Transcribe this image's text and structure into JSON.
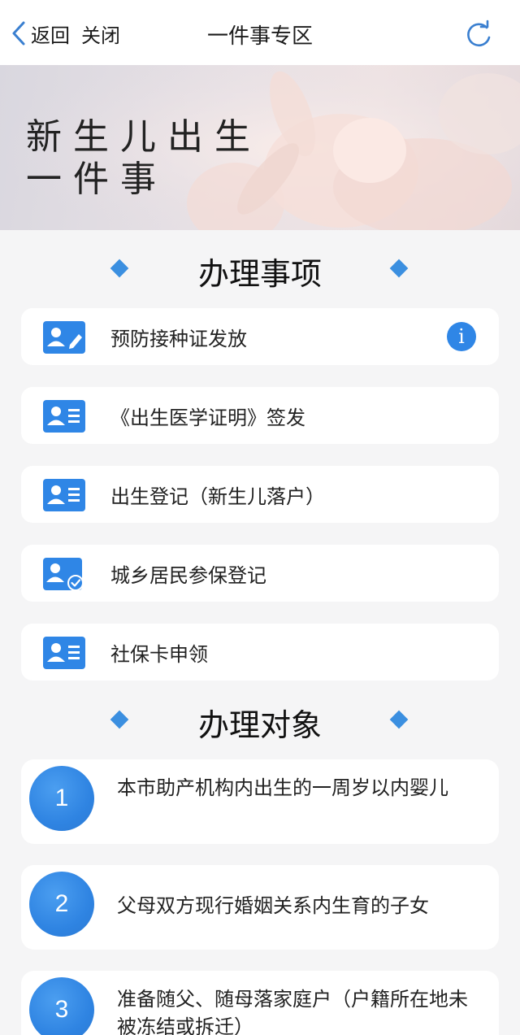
{
  "nav": {
    "back_label": "返回",
    "close_label": "关闭",
    "title": "一件事专区"
  },
  "banner": {
    "line1": "新生儿出生",
    "line2": "一件事"
  },
  "section_items": {
    "title": "办理事项"
  },
  "items": [
    {
      "label": "预防接种证发放",
      "icon": "id-card-edit-icon",
      "has_info": true
    },
    {
      "label": "《出生医学证明》签发",
      "icon": "id-card-icon"
    },
    {
      "label": "出生登记（新生儿落户）",
      "icon": "id-card-icon"
    },
    {
      "label": "城乡居民参保登记",
      "icon": "id-card-check-icon"
    },
    {
      "label": "社保卡申领",
      "icon": "id-card-icon"
    }
  ],
  "info_icon_glyph": "i",
  "section_targets": {
    "title": "办理对象"
  },
  "targets": [
    {
      "num": "1",
      "text": "本市助产机构内出生的一周岁以内婴儿"
    },
    {
      "num": "2",
      "text": "父母双方现行婚姻关系内生育的子女"
    },
    {
      "num": "3",
      "text": "准备随父、随母落家庭户（户籍所在地未被冻结或拆迁）"
    }
  ],
  "colors": {
    "accent": "#2f86e6",
    "diamond": "#3b8fe0",
    "background": "#f5f5f6"
  }
}
